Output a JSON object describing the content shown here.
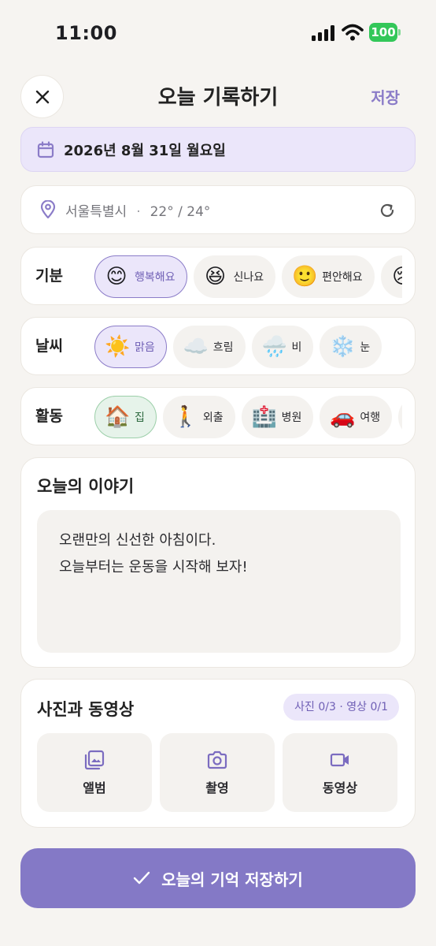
{
  "status": {
    "time": "11:00",
    "battery": "100"
  },
  "header": {
    "title": "오늘 기록하기",
    "save_label": "저장"
  },
  "date": {
    "text": "2026년 8월 31일 월요일"
  },
  "location": {
    "city": "서울특별시",
    "separator": "·",
    "temperature": "22° / 24°"
  },
  "mood": {
    "label": "기분",
    "chips": [
      {
        "emoji": "😊",
        "label": "행복해요",
        "selected": true
      },
      {
        "emoji": "😆",
        "label": "신나요",
        "selected": false
      },
      {
        "emoji": "🙂",
        "label": "편안해요",
        "selected": false
      },
      {
        "emoji": "😢",
        "label": "",
        "selected": false
      }
    ]
  },
  "weather": {
    "label": "날씨",
    "chips": [
      {
        "emoji": "☀️",
        "label": "맑음",
        "selected": true
      },
      {
        "emoji": "☁️",
        "label": "흐림",
        "selected": false
      },
      {
        "emoji": "🌧️",
        "label": "비",
        "selected": false
      },
      {
        "emoji": "❄️",
        "label": "눈",
        "selected": false
      }
    ]
  },
  "activity": {
    "label": "활동",
    "chips": [
      {
        "emoji": "🏠",
        "label": "집",
        "selected": true
      },
      {
        "emoji": "🚶",
        "label": "외출",
        "selected": false
      },
      {
        "emoji": "🏥",
        "label": "병원",
        "selected": false
      },
      {
        "emoji": "🚗",
        "label": "여행",
        "selected": false
      },
      {
        "emoji": "📈",
        "label": "",
        "selected": false
      }
    ]
  },
  "story": {
    "title": "오늘의 이야기",
    "lines": [
      "오랜만의 신선한 아침이다.",
      "오늘부터는 운동을 시작해 보자!"
    ]
  },
  "media": {
    "title": "사진과 동영상",
    "count": "사진 0/3 · 영상 0/1",
    "buttons": [
      {
        "icon": "album-icon",
        "label": "앨범"
      },
      {
        "icon": "camera-icon",
        "label": "촬영"
      },
      {
        "icon": "video-icon",
        "label": "동영상"
      }
    ]
  },
  "save_button": {
    "label": "오늘의 기억 저장하기"
  },
  "colors": {
    "accent": "#8b7cc8",
    "save_bg": "#8479c6",
    "selected_green": "#9ccfa9"
  }
}
